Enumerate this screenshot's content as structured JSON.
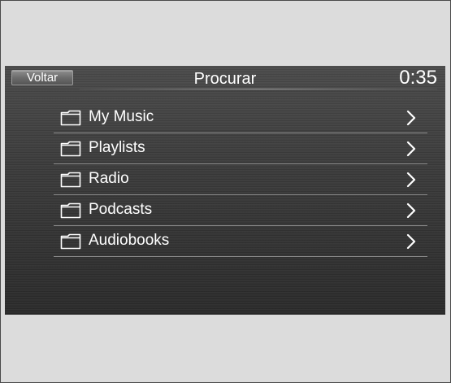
{
  "header": {
    "back_label": "Voltar",
    "title": "Procurar",
    "clock": "0:35"
  },
  "menu": {
    "items": [
      {
        "label": "My Music",
        "icon": "folder-icon",
        "action_icon": "chevron-right-icon"
      },
      {
        "label": "Playlists",
        "icon": "folder-icon",
        "action_icon": "chevron-right-icon"
      },
      {
        "label": "Radio",
        "icon": "folder-icon",
        "action_icon": "chevron-right-icon"
      },
      {
        "label": "Podcasts",
        "icon": "folder-icon",
        "action_icon": "chevron-right-icon"
      },
      {
        "label": "Audiobooks",
        "icon": "folder-icon",
        "action_icon": "chevron-right-icon"
      }
    ]
  },
  "colors": {
    "text": "#ffffff",
    "screen_background": "#3a3a3a",
    "divider": "#8a8a8a",
    "page_background": "#dcdcdc"
  }
}
